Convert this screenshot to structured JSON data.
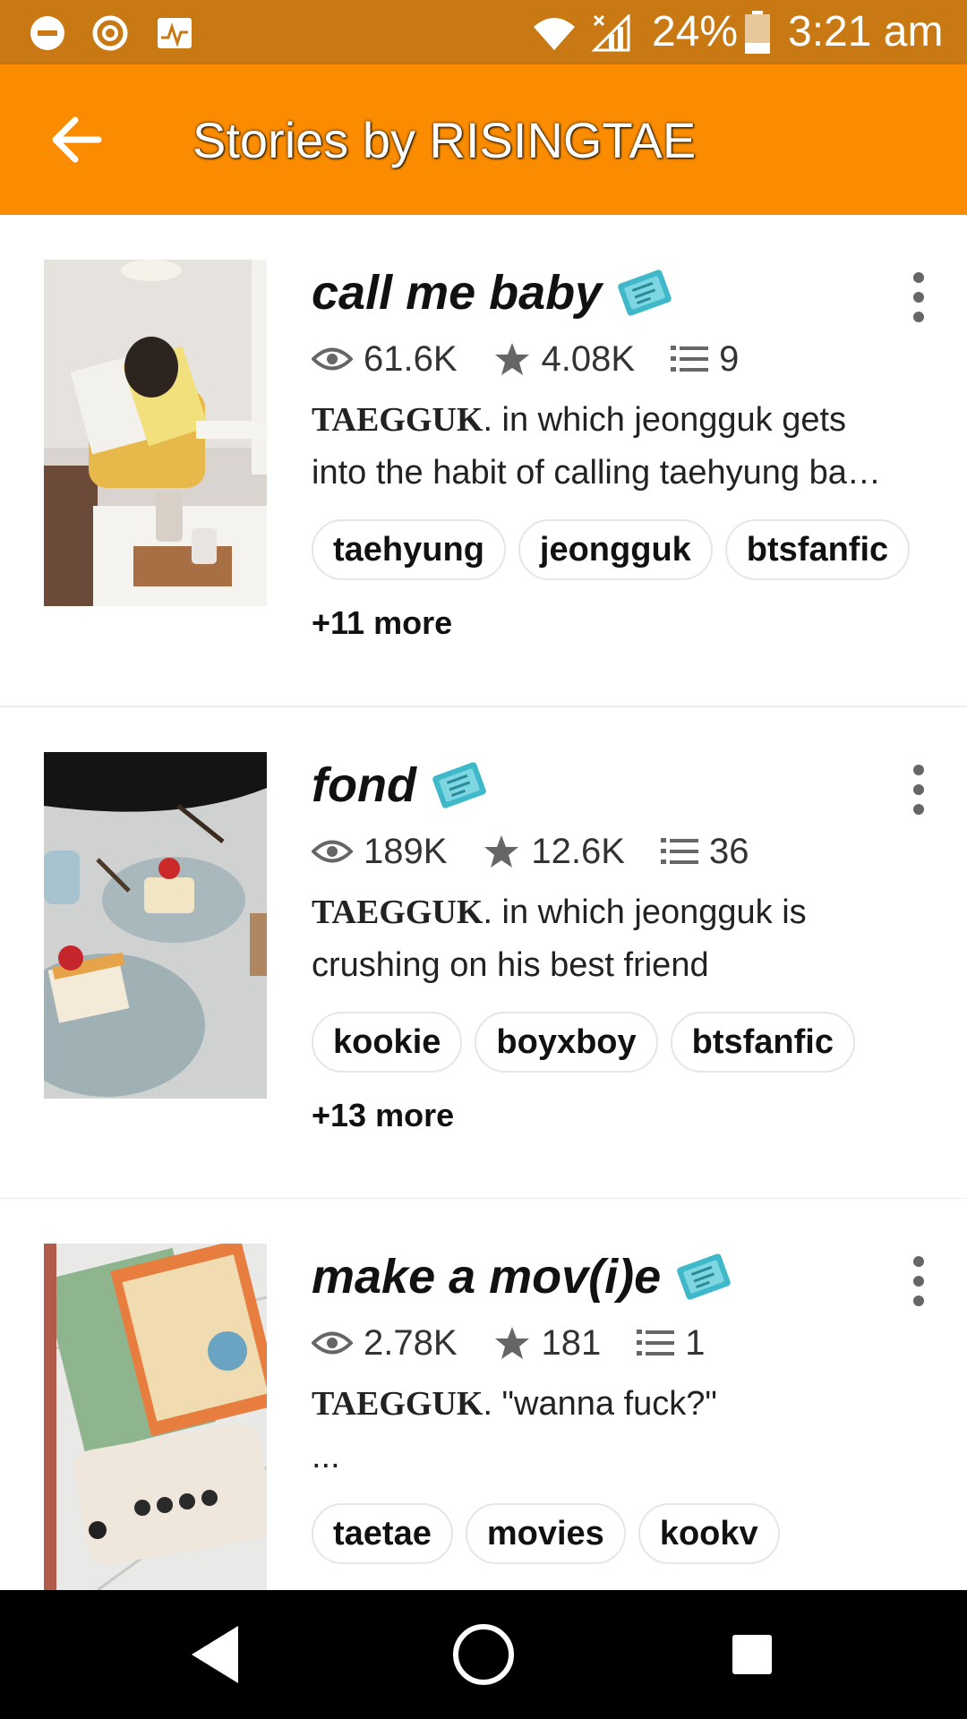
{
  "status_bar": {
    "battery": "24%",
    "time": "3:21 am",
    "left_icons": [
      "do-not-disturb-icon",
      "sync-icon",
      "activity-icon"
    ],
    "right_icons": [
      "wifi-icon",
      "signal-icon",
      "battery-icon"
    ]
  },
  "app_bar": {
    "title": "Stories by RISINGTAE",
    "background_color": "#fb8c00"
  },
  "stories": [
    {
      "title": "call me baby",
      "views": "61.6K",
      "votes": "4.08K",
      "parts": "9",
      "desc_prefix": "TAEGGUK",
      "desc_line1": ". in which jeongguk gets",
      "desc_line2": "into the habit of calling taehyung ba…",
      "tags": [
        "taehyung",
        "jeongguk",
        "btsfanfic"
      ],
      "more": "+11 more"
    },
    {
      "title": "fond",
      "views": "189K",
      "votes": "12.6K",
      "parts": "36",
      "desc_prefix": "TAEGGUK",
      "desc_line1": ". in which jeongguk is",
      "desc_line2": "crushing on his best friend",
      "tags": [
        "kookie",
        "boyxboy",
        "btsfanfic"
      ],
      "more": "+13 more"
    },
    {
      "title": "make a mov(i)e",
      "views": "2.78K",
      "votes": "181",
      "parts": "1",
      "desc_prefix": "TAEGGUK",
      "desc_line1": ". \"wanna fuck?\"",
      "desc_line2": "...",
      "tags": [
        "taetae",
        "movies",
        "kookv"
      ],
      "more": ""
    }
  ],
  "nav_bar": {
    "buttons": [
      "back-nav-icon",
      "home-nav-icon",
      "recents-nav-icon"
    ]
  }
}
